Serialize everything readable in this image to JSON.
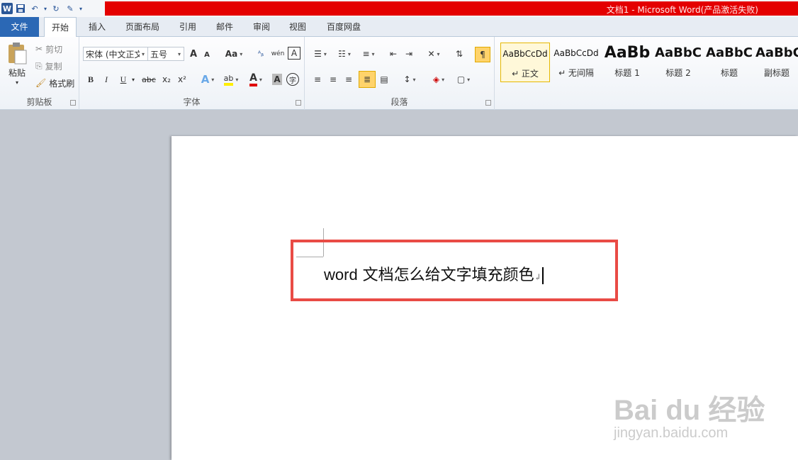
{
  "window": {
    "title": "文档1 - Microsoft Word(产品激活失败)"
  },
  "tabs": [
    "文件",
    "开始",
    "插入",
    "页面布局",
    "引用",
    "邮件",
    "审阅",
    "视图",
    "百度网盘"
  ],
  "clipboard": {
    "paste": "粘贴",
    "cut": "剪切",
    "copy": "复制",
    "format_painter": "格式刷",
    "label": "剪贴板"
  },
  "font": {
    "name": "宋体 (中文正文)",
    "size": "五号",
    "label": "字体",
    "grow": "A",
    "shrink": "A",
    "case": "Aa",
    "bold": "B",
    "italic": "I",
    "underline": "U",
    "strike": "abc",
    "sub": "x₂",
    "sup": "x²",
    "phonetic": "wén",
    "charborder": "A",
    "enclose": "字"
  },
  "paragraph": {
    "label": "段落"
  },
  "styles": {
    "items": [
      {
        "sample": "AaBbCcDd",
        "name": "↵ 正文"
      },
      {
        "sample": "AaBbCcDd",
        "name": "↵ 无间隔"
      },
      {
        "sample": "AaBb",
        "name": "标题 1"
      },
      {
        "sample": "AaBbC",
        "name": "标题 2"
      },
      {
        "sample": "AaBbC",
        "name": "标题"
      },
      {
        "sample": "AaBbC",
        "name": "副标题"
      }
    ]
  },
  "document": {
    "text_latin": "word",
    "text_cn": " 文档怎么给文字填充颜色",
    "pilcrow": "↲"
  },
  "watermark": {
    "main": "Bai du 经验",
    "sub": "jingyan.baidu.com"
  },
  "colors": {
    "title_bar": "#e40000",
    "file_tab": "#2b68b5",
    "highlight_box": "#e94b45"
  }
}
